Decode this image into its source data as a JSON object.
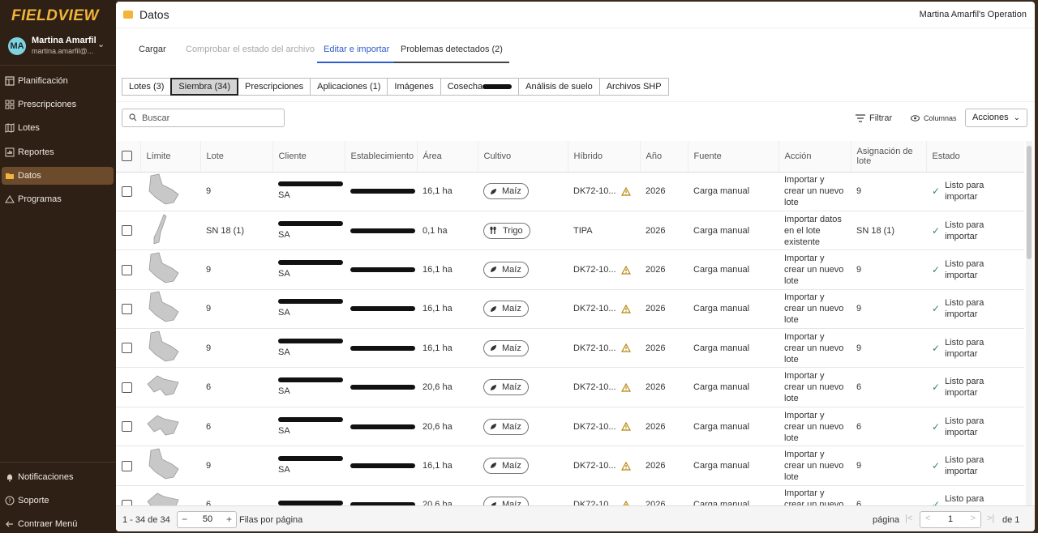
{
  "app": {
    "logo": "FIELDVIEW",
    "user_initials": "MA",
    "user_name": "Martina Amarfil",
    "user_email": "martina.amarfil@..."
  },
  "sidebar": {
    "items": [
      {
        "label": "Planificación",
        "icon": "planning-icon"
      },
      {
        "label": "Prescripciones",
        "icon": "grid-icon"
      },
      {
        "label": "Lotes",
        "icon": "map-icon"
      },
      {
        "label": "Reportes",
        "icon": "chart-icon"
      },
      {
        "label": "Datos",
        "icon": "folder-icon",
        "active": true
      },
      {
        "label": "Programas",
        "icon": "programs-icon"
      }
    ],
    "bottom": [
      {
        "label": "Notificaciones",
        "icon": "bell-icon"
      },
      {
        "label": "Soporte",
        "icon": "help-icon"
      },
      {
        "label": "Contraer Menú",
        "icon": "collapse-icon"
      }
    ]
  },
  "header": {
    "title": "Datos",
    "operation": "Martina Amarfil's Operation"
  },
  "tabs": [
    {
      "label": "Cargar"
    },
    {
      "label": "Comprobar el estado del archivo",
      "disabled": true
    },
    {
      "label": "Editar e importar",
      "active": true
    },
    {
      "label": "Problemas detectados (2)"
    }
  ],
  "subtabs": [
    {
      "label": "Lotes (3)"
    },
    {
      "label": "Siembra (34)",
      "active": true
    },
    {
      "label": "Prescripciones"
    },
    {
      "label": "Aplicaciones (1)"
    },
    {
      "label": "Imágenes"
    },
    {
      "label": "Cosecha",
      "redacted": true
    },
    {
      "label": "Análisis de suelo"
    },
    {
      "label": "Archivos SHP"
    }
  ],
  "toolbar": {
    "search_placeholder": "Buscar",
    "filter_label": "Filtrar",
    "columns_label": "Columnas",
    "actions_label": "Acciones"
  },
  "table": {
    "headers": [
      "Límite",
      "Lote",
      "Cliente",
      "Establecimiento",
      "Área",
      "Cultivo",
      "Híbrido",
      "Año",
      "Fuente",
      "Acción",
      "Asignación de lote",
      "Estado"
    ],
    "rows": [
      {
        "shape": "a",
        "lote": "9",
        "cliente_suffix": "SA",
        "area": "16,1 ha",
        "cultivo": "Maíz",
        "hibrido": "DK72-10...",
        "warn": true,
        "anio": "2026",
        "fuente": "Carga manual",
        "accion": "Importar y crear un nuevo lote",
        "asignacion": "9",
        "estado": "Listo para importar"
      },
      {
        "shape": "b",
        "lote": "SN 18 (1)",
        "cliente_suffix": "SA",
        "area": "0,1 ha",
        "cultivo": "Trigo",
        "hibrido": "TIPA",
        "warn": false,
        "anio": "2026",
        "fuente": "Carga manual",
        "accion": "Importar datos en el lote existente",
        "asignacion": "SN 18 (1)",
        "estado": "Listo para importar"
      },
      {
        "shape": "a",
        "lote": "9",
        "cliente_suffix": "SA",
        "area": "16,1 ha",
        "cultivo": "Maíz",
        "hibrido": "DK72-10...",
        "warn": true,
        "anio": "2026",
        "fuente": "Carga manual",
        "accion": "Importar y crear un nuevo lote",
        "asignacion": "9",
        "estado": "Listo para importar"
      },
      {
        "shape": "a",
        "lote": "9",
        "cliente_suffix": "SA",
        "area": "16,1 ha",
        "cultivo": "Maíz",
        "hibrido": "DK72-10...",
        "warn": true,
        "anio": "2026",
        "fuente": "Carga manual",
        "accion": "Importar y crear un nuevo lote",
        "asignacion": "9",
        "estado": "Listo para importar"
      },
      {
        "shape": "a",
        "lote": "9",
        "cliente_suffix": "SA",
        "area": "16,1 ha",
        "cultivo": "Maíz",
        "hibrido": "DK72-10...",
        "warn": true,
        "anio": "2026",
        "fuente": "Carga manual",
        "accion": "Importar y crear un nuevo lote",
        "asignacion": "9",
        "estado": "Listo para importar"
      },
      {
        "shape": "c",
        "lote": "6",
        "cliente_suffix": "SA",
        "area": "20,6 ha",
        "cultivo": "Maíz",
        "hibrido": "DK72-10...",
        "warn": true,
        "anio": "2026",
        "fuente": "Carga manual",
        "accion": "Importar y crear un nuevo lote",
        "asignacion": "6",
        "estado": "Listo para importar"
      },
      {
        "shape": "c",
        "lote": "6",
        "cliente_suffix": "SA",
        "area": "20,6 ha",
        "cultivo": "Maíz",
        "hibrido": "DK72-10...",
        "warn": true,
        "anio": "2026",
        "fuente": "Carga manual",
        "accion": "Importar y crear un nuevo lote",
        "asignacion": "6",
        "estado": "Listo para importar"
      },
      {
        "shape": "a",
        "lote": "9",
        "cliente_suffix": "SA",
        "area": "16,1 ha",
        "cultivo": "Maíz",
        "hibrido": "DK72-10...",
        "warn": true,
        "anio": "2026",
        "fuente": "Carga manual",
        "accion": "Importar y crear un nuevo lote",
        "asignacion": "9",
        "estado": "Listo para importar"
      },
      {
        "shape": "c",
        "lote": "6",
        "cliente_suffix": "",
        "area": "20,6 ha",
        "cultivo": "Maíz",
        "hibrido": "DK72-10...",
        "warn": true,
        "anio": "2026",
        "fuente": "Carga manual",
        "accion": "Importar y crear un nuevo lote",
        "asignacion": "6",
        "estado": "Listo para importar"
      }
    ]
  },
  "footer": {
    "range": "1 - 34 de 34",
    "per_page_value": "50",
    "per_page_label": "Filas por página",
    "page_label": "página",
    "page_value": "1",
    "of_label": "de 1"
  },
  "colors": {
    "sidebar_bg": "#2e2015",
    "accent_blue": "#2f5ccf",
    "logo": "#f2b53a",
    "check_green": "#2e8b57",
    "warn": "#b8860b"
  }
}
